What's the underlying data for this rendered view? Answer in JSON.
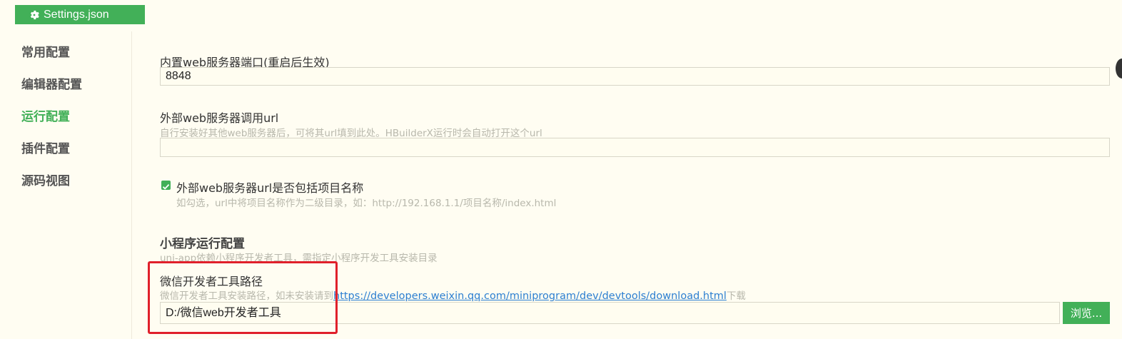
{
  "tab": {
    "title": "Settings.json",
    "icon": "gear-icon",
    "color": "#42b058"
  },
  "sidebar": {
    "items": [
      {
        "label": "常用配置",
        "active": false
      },
      {
        "label": "编辑器配置",
        "active": false
      },
      {
        "label": "运行配置",
        "active": true
      },
      {
        "label": "插件配置",
        "active": false
      },
      {
        "label": "源码视图",
        "active": false
      }
    ]
  },
  "main": {
    "port": {
      "label": "内置web服务器端口(重启后生效)",
      "value": "8848"
    },
    "external_url": {
      "label": "外部web服务器调用url",
      "hint": "自行安装好其他web服务器后，可将其url填到此处。HBuilderX运行时会自动打开这个url",
      "value": ""
    },
    "include_project": {
      "label": "外部web服务器url是否包括项目名称",
      "hint": "如勾选，url中将项目名称作为二级目录，如：http://192.168.1.1/项目名称/index.html",
      "checked": true
    },
    "miniprogram": {
      "title": "小程序运行配置",
      "hint": "uni-app依赖小程序开发者工具，需指定小程序开发工具安装目录"
    },
    "wechat_path": {
      "label": "微信开发者工具路径",
      "hint_prefix": "微信开发者工具安装路径，如未安装请到",
      "hint_link": "https://developers.weixin.qq.com/miniprogram/dev/devtools/download.html",
      "hint_suffix": "下载",
      "value": "D:/微信web开发者工具",
      "browse_label": "浏览..."
    }
  },
  "colors": {
    "accent": "#42b058",
    "highlight": "#e0202b",
    "link": "#2c7fd1",
    "background": "#fffdf2"
  }
}
